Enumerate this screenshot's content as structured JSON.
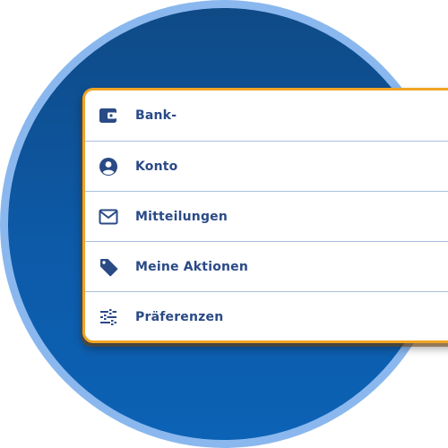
{
  "menu": {
    "items": [
      {
        "label": "Bank-",
        "icon": "wallet-icon"
      },
      {
        "label": "Konto",
        "icon": "account-circle-icon"
      },
      {
        "label": "Mitteilungen",
        "icon": "mail-icon"
      },
      {
        "label": "Meine Aktionen",
        "icon": "tag-icon"
      },
      {
        "label": "Präferenzen",
        "icon": "sliders-icon"
      }
    ]
  },
  "colors": {
    "background_gradient_top": "#0f4a86",
    "background_gradient_bottom": "#0c62b5",
    "ring": "#8ab8ee",
    "card_border": "#f0a524",
    "label_text": "#2a4a86",
    "icon": "#2a4a86",
    "divider": "#a9bfdc"
  }
}
